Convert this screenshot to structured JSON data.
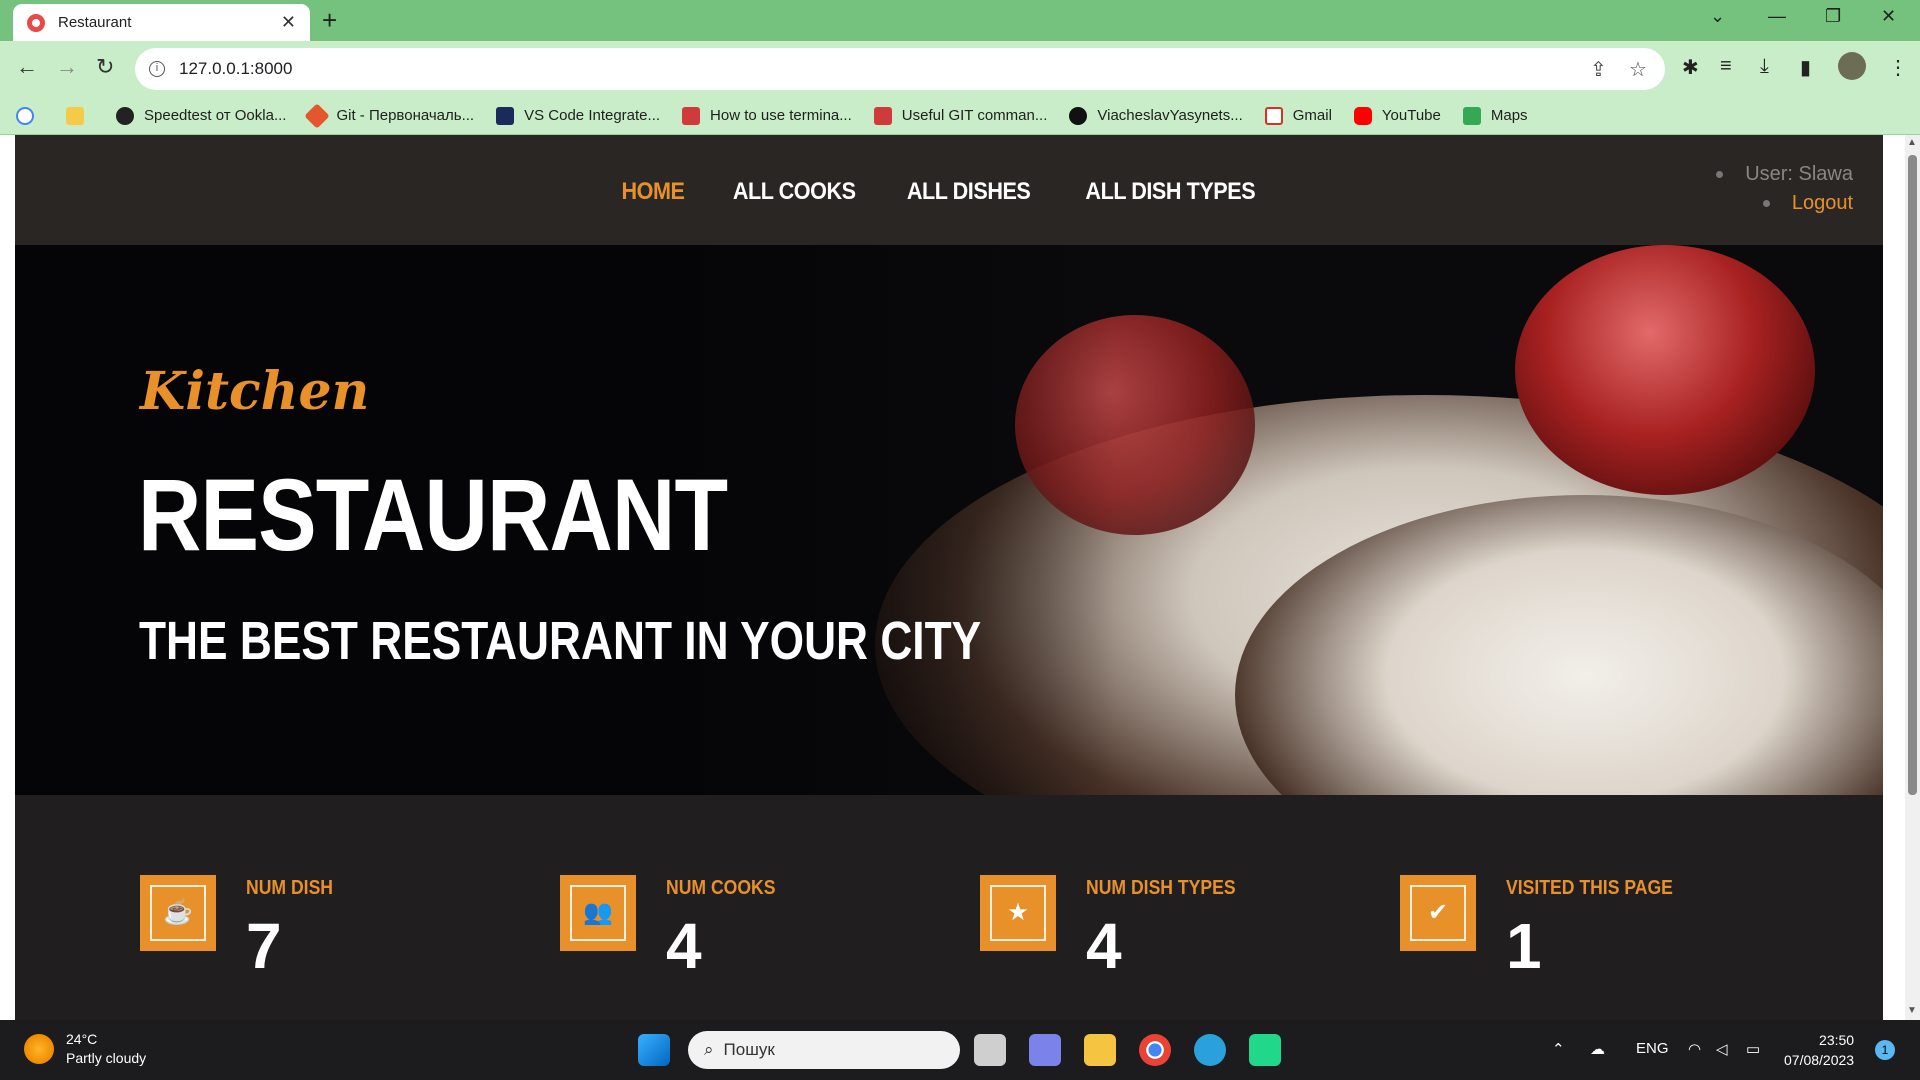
{
  "browser": {
    "tab_title": "Restaurant",
    "url": "127.0.0.1:8000",
    "bookmarks": [
      {
        "label": "Speedtest от Ookla...",
        "color": "#222222"
      },
      {
        "label": "Git - Первоначаль...",
        "color": "#e4572e"
      },
      {
        "label": "VS Code Integrate...",
        "color": "#1a2a5a"
      },
      {
        "label": "How to use termina...",
        "color": "#d03a3a"
      },
      {
        "label": "Useful GIT comman...",
        "color": "#d03a3a"
      },
      {
        "label": "ViacheslavYasynets...",
        "color": "#111111"
      },
      {
        "label": "Gmail",
        "color": "#d93025"
      },
      {
        "label": "YouTube",
        "color": "#ff0000"
      },
      {
        "label": "Maps",
        "color": "#34a853"
      }
    ]
  },
  "nav": {
    "items": [
      {
        "label": "HOME",
        "active": true
      },
      {
        "label": "ALL COOKS",
        "active": false
      },
      {
        "label": "ALL DISHES",
        "active": false
      },
      {
        "label": "ALL DISH TYPES",
        "active": false
      }
    ],
    "user_label": "User: Slawa",
    "logout_label": "Logout"
  },
  "hero": {
    "script_title": "Kitchen",
    "title": "RESTAURANT",
    "subtitle": "THE BEST RESTAURANT IN YOUR CITY"
  },
  "stats": [
    {
      "label": "NUM DISH",
      "value": "7",
      "icon": "coffee-icon",
      "glyph": "☕"
    },
    {
      "label": "NUM COOKS",
      "value": "4",
      "icon": "users-icon",
      "glyph": "👥"
    },
    {
      "label": "NUM DISH TYPES",
      "value": "4",
      "icon": "star-icon",
      "glyph": "★"
    },
    {
      "label": "VISITED THIS PAGE",
      "value": "1",
      "icon": "check-icon",
      "glyph": "✔"
    }
  ],
  "taskbar": {
    "temperature": "24°C",
    "weather": "Partly cloudy",
    "search_placeholder": "Пошук",
    "language": "ENG",
    "time": "23:50",
    "date": "07/08/2023",
    "notifications": "1"
  },
  "colors": {
    "accent": "#e8912a",
    "tabstrip": "#74c27d",
    "toolbar": "#c9ecc9"
  }
}
